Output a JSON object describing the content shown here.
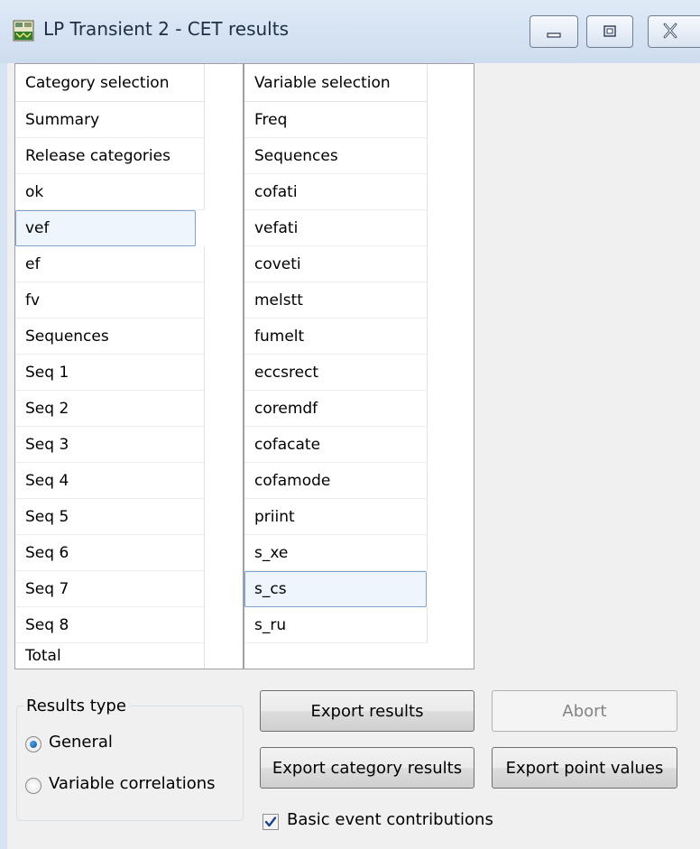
{
  "window": {
    "title": "LP Transient 2 - CET results",
    "icon": "lp-app-icon",
    "controls": [
      "minimize-icon",
      "maximize-icon",
      "close-icon"
    ]
  },
  "category_list": {
    "header": "Category selection",
    "items": [
      "Summary",
      "Release categories",
      "ok",
      "vef",
      "ef",
      "fv",
      "Sequences",
      "Seq 1",
      "Seq 2",
      "Seq 3",
      "Seq 4",
      "Seq 5",
      "Seq 6",
      "Seq 7",
      "Seq 8",
      "Total"
    ],
    "selected": "vef"
  },
  "variable_list": {
    "header": "Variable selection",
    "items": [
      "Freq",
      "Sequences",
      "cofati",
      "vefati",
      "coveti",
      "melstt",
      "fumelt",
      "eccsrect",
      "coremdf",
      "cofacate",
      "cofamode",
      "priint",
      "s_xe",
      "s_cs",
      "s_ru"
    ],
    "selected": "s_cs"
  },
  "results_type": {
    "label": "Results type",
    "options": [
      "General",
      "Variable correlations"
    ],
    "selected": "General"
  },
  "buttons": {
    "export_results": "Export results",
    "abort": "Abort",
    "export_category_results": "Export category results",
    "export_point_values": "Export point values"
  },
  "basic_event_contributions": {
    "label": "Basic event contributions",
    "checked": true
  },
  "colors": {
    "titlebar": "#d7e4f2",
    "selection_border": "#7da2ce",
    "selection_fill": "#eef5fd"
  }
}
